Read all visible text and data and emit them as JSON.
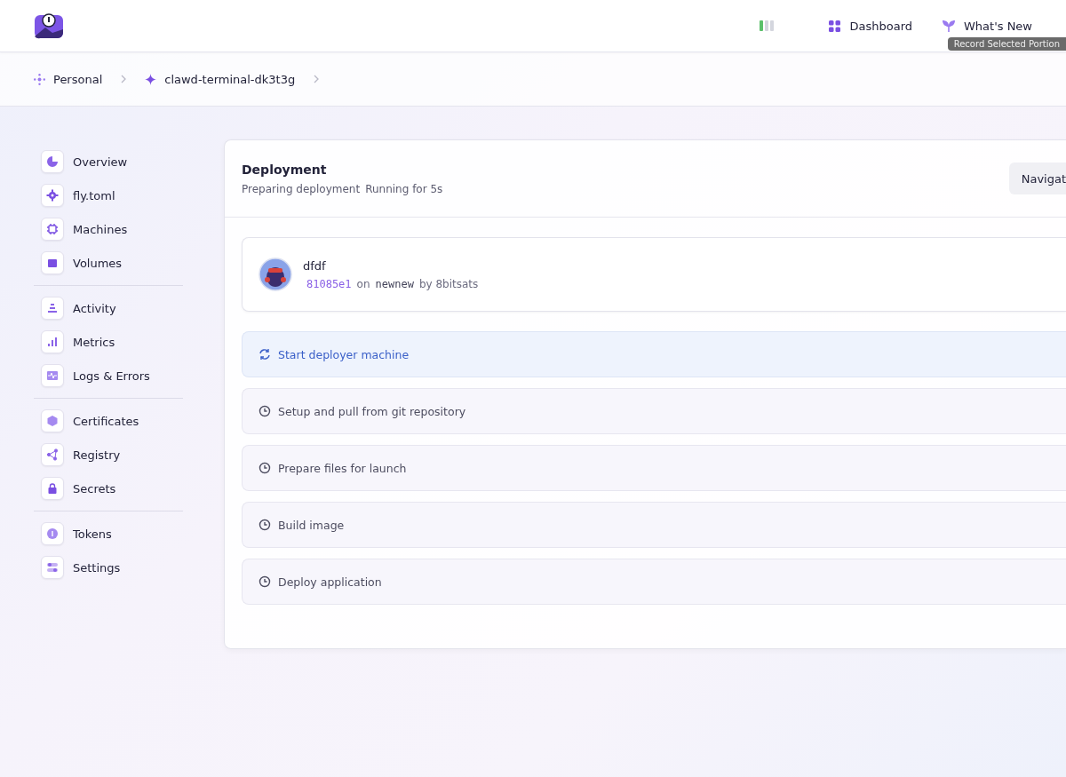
{
  "header": {
    "status_bars": [
      {
        "on": true
      },
      {
        "on": false
      },
      {
        "on": false
      }
    ],
    "nav": [
      {
        "label": "Dashboard"
      },
      {
        "label": "What's New"
      }
    ],
    "overlay_tooltip": "Record Selected Portion"
  },
  "breadcrumbs": [
    {
      "label": "Personal"
    },
    {
      "label": "clawd-terminal-dk3t3g"
    }
  ],
  "sidebar": {
    "groups": [
      {
        "items": [
          {
            "label": "Overview"
          },
          {
            "label": "fly.toml"
          },
          {
            "label": "Machines"
          },
          {
            "label": "Volumes"
          }
        ]
      },
      {
        "items": [
          {
            "label": "Activity"
          },
          {
            "label": "Metrics"
          },
          {
            "label": "Logs & Errors"
          }
        ]
      },
      {
        "items": [
          {
            "label": "Certificates"
          },
          {
            "label": "Registry"
          },
          {
            "label": "Secrets"
          }
        ]
      },
      {
        "items": [
          {
            "label": "Tokens"
          },
          {
            "label": "Settings"
          }
        ]
      }
    ]
  },
  "deployment": {
    "title": "Deployment",
    "status": "Preparing deployment",
    "elapsed": "Running for 5s",
    "button": "Navigat",
    "commit": {
      "message": "dfdf",
      "sha": "81085e1",
      "on_text": "on",
      "branch": "newnew",
      "by_text": "by 8bitsats"
    },
    "steps": [
      {
        "label": "Start deployer machine",
        "kind": "running"
      },
      {
        "label": "Setup and pull from git repository",
        "kind": "pending"
      },
      {
        "label": "Prepare files for launch",
        "kind": "pending"
      },
      {
        "label": "Build image",
        "kind": "pending"
      },
      {
        "label": "Deploy application",
        "kind": "pending"
      }
    ]
  }
}
